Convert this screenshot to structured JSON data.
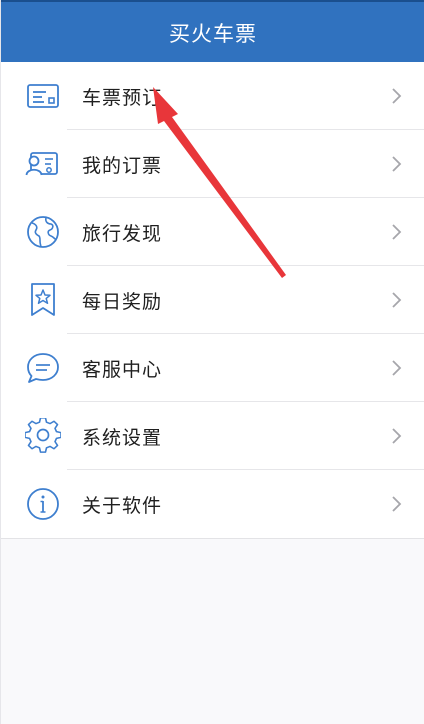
{
  "header": {
    "title": "买火车票"
  },
  "menu": {
    "items": [
      {
        "label": "车票预订",
        "icon": "ticket-card-icon"
      },
      {
        "label": "我的订票",
        "icon": "id-card-icon"
      },
      {
        "label": "旅行发现",
        "icon": "globe-icon"
      },
      {
        "label": "每日奖励",
        "icon": "star-bookmark-icon"
      },
      {
        "label": "客服中心",
        "icon": "chat-bubble-icon"
      },
      {
        "label": "系统设置",
        "icon": "gear-icon"
      },
      {
        "label": "关于软件",
        "icon": "info-icon"
      }
    ]
  },
  "colors": {
    "header_bg": "#3072bf",
    "icon_stroke": "#3e7fcf",
    "annotation_arrow": "#e8363a"
  }
}
